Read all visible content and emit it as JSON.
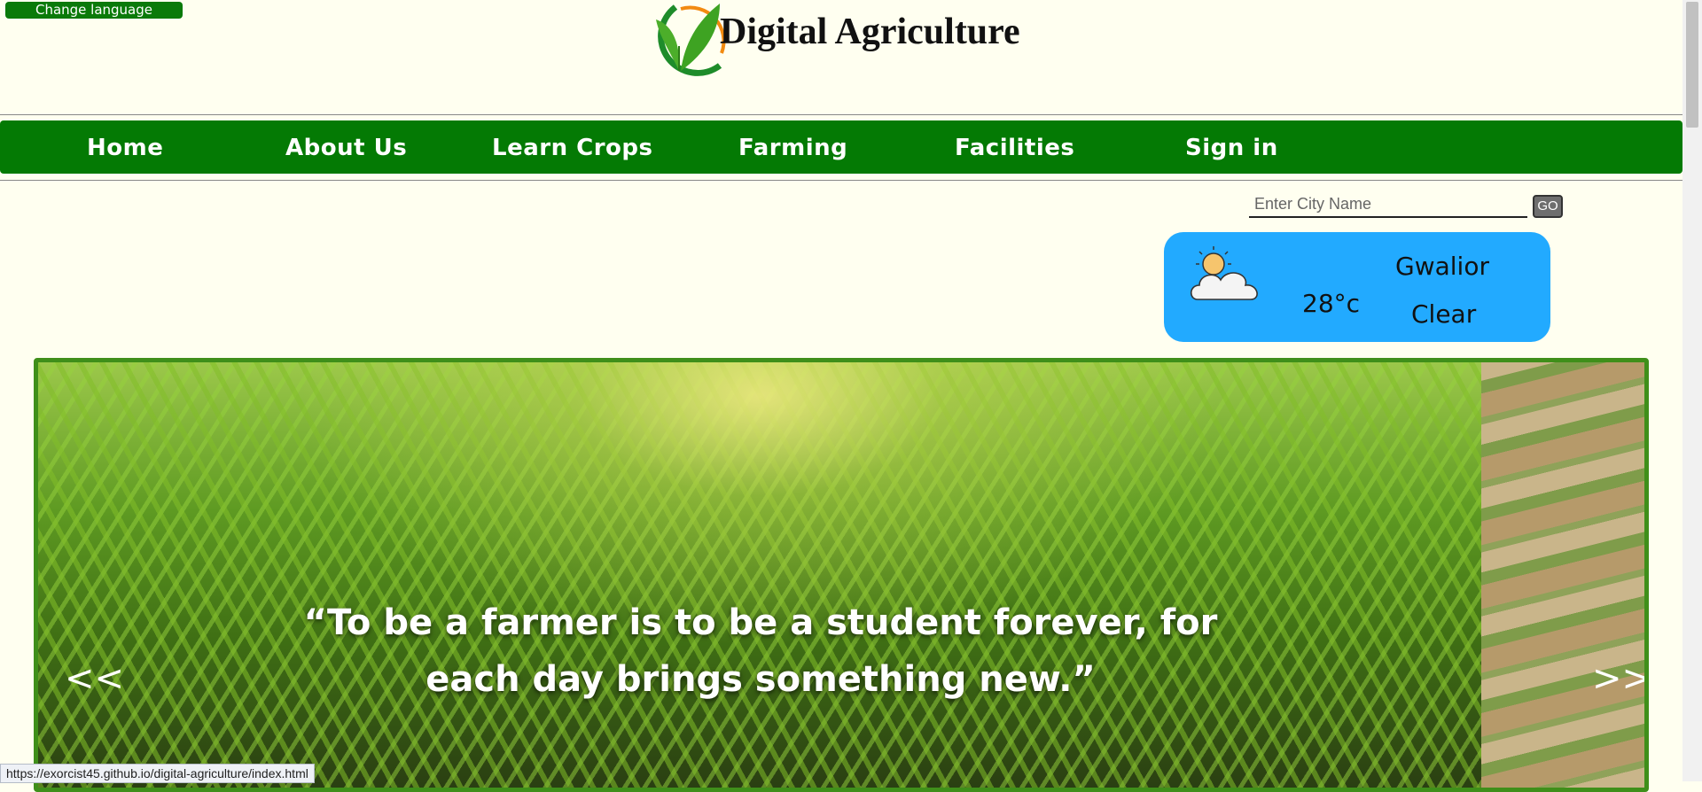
{
  "language_button": "Change language",
  "brand": {
    "title": "Digital Agriculture"
  },
  "nav": {
    "items": [
      {
        "label": "Home"
      },
      {
        "label": "About  Us"
      },
      {
        "label": "Learn  Crops"
      },
      {
        "label": "Farming"
      },
      {
        "label": "Facilities"
      },
      {
        "label": "Sign  in"
      }
    ]
  },
  "search": {
    "placeholder": "Enter City Name",
    "button": "GO"
  },
  "weather": {
    "temperature": "28°c",
    "city": "Gwalior",
    "condition": "Clear",
    "icon": "partly-cloudy-icon"
  },
  "slider": {
    "quote_line1": "“To be a farmer is to be a student forever, for",
    "quote_line2": "each day brings something new.”",
    "prev": "<<",
    "next": ">>"
  },
  "status_url": "https://exorcist45.github.io/digital-agriculture/index.html",
  "colors": {
    "nav": "#047a04",
    "weather_card": "#22aaff",
    "page_bg": "#fffff0",
    "slider_border": "#3f8f1a"
  }
}
